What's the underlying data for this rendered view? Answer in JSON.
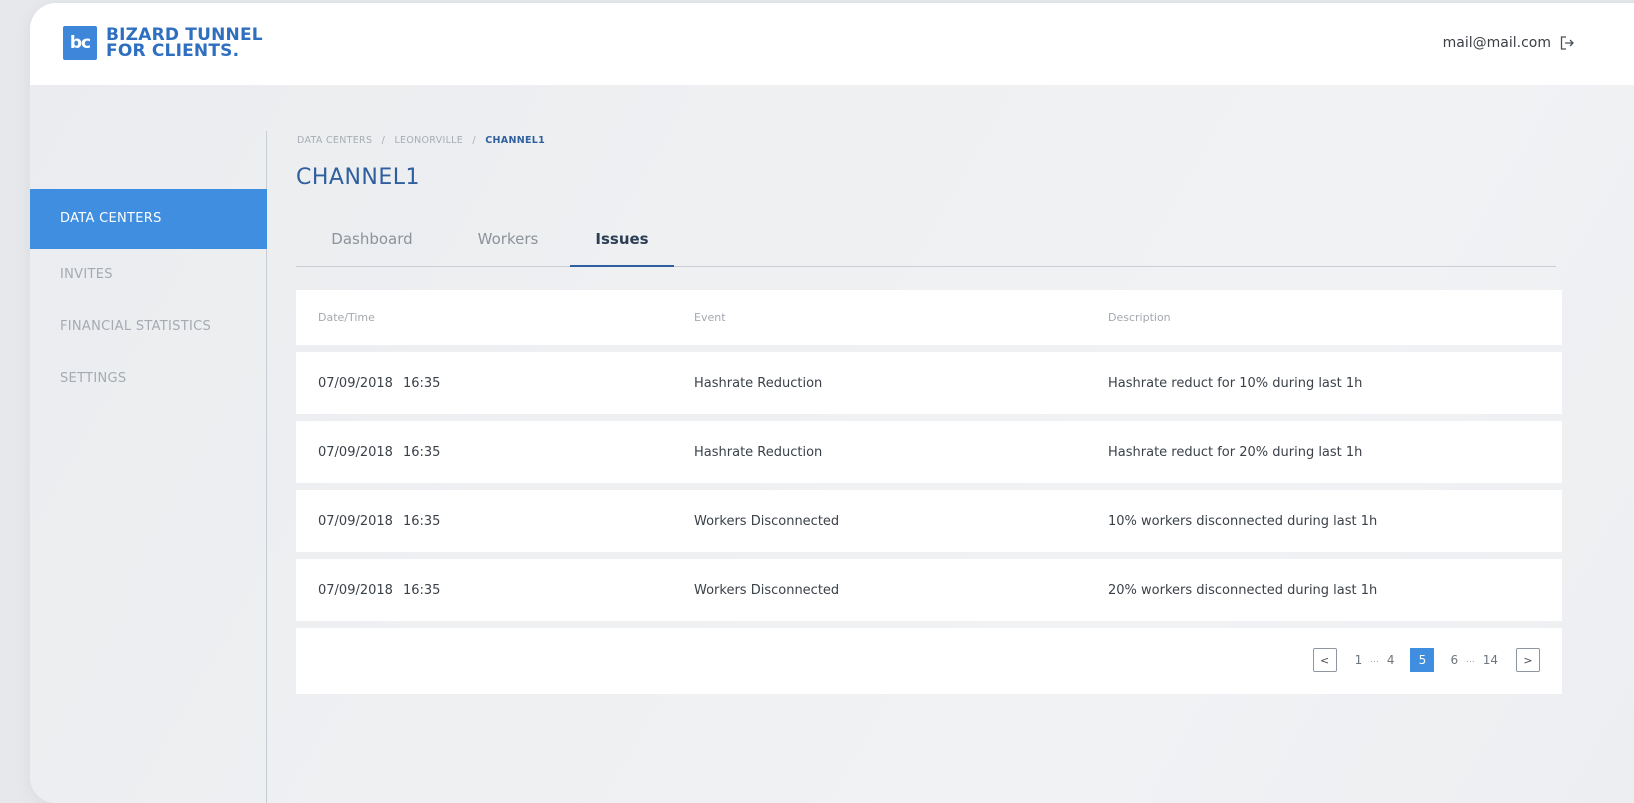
{
  "brand": {
    "mark": "bc",
    "line1": "BIZARD TUNNEL",
    "line2": "FOR CLIENTS."
  },
  "header": {
    "user_email": "mail@mail.com"
  },
  "sidebar": {
    "items": [
      {
        "label": "DATA CENTERS",
        "active": true
      },
      {
        "label": "INVITES",
        "active": false
      },
      {
        "label": "FINANCIAL STATISTICS",
        "active": false
      },
      {
        "label": "SETTINGS",
        "active": false
      }
    ]
  },
  "breadcrumb": {
    "items": [
      "DATA CENTERS",
      "LEONORVILLE",
      "CHANNEL1"
    ],
    "separator": "/"
  },
  "page": {
    "title": "CHANNEL1"
  },
  "tabs": [
    {
      "label": "Dashboard",
      "active": false
    },
    {
      "label": "Workers",
      "active": false
    },
    {
      "label": "Issues",
      "active": true
    }
  ],
  "table": {
    "columns": [
      "Date/Time",
      "Event",
      "Description"
    ],
    "rows": [
      {
        "date": "07/09/2018",
        "time": "16:35",
        "event": "Hashrate Reduction",
        "description": "Hashrate reduct for 10% during last 1h"
      },
      {
        "date": "07/09/2018",
        "time": "16:35",
        "event": "Hashrate Reduction",
        "description": "Hashrate reduct for 20% during last 1h"
      },
      {
        "date": "07/09/2018",
        "time": "16:35",
        "event": "Workers Disconnected",
        "description": "10% workers disconnected during last 1h"
      },
      {
        "date": "07/09/2018",
        "time": "16:35",
        "event": "Workers Disconnected",
        "description": "20% workers disconnected during last 1h"
      }
    ]
  },
  "pagination": {
    "prev": "<",
    "next": ">",
    "first": "1",
    "ellipsis": "...",
    "before": "4",
    "current": "5",
    "after": "6",
    "last": "14"
  },
  "colors": {
    "accent": "#3f8ee0",
    "title": "#2f5f9e",
    "brand": "#2f6fc0"
  }
}
